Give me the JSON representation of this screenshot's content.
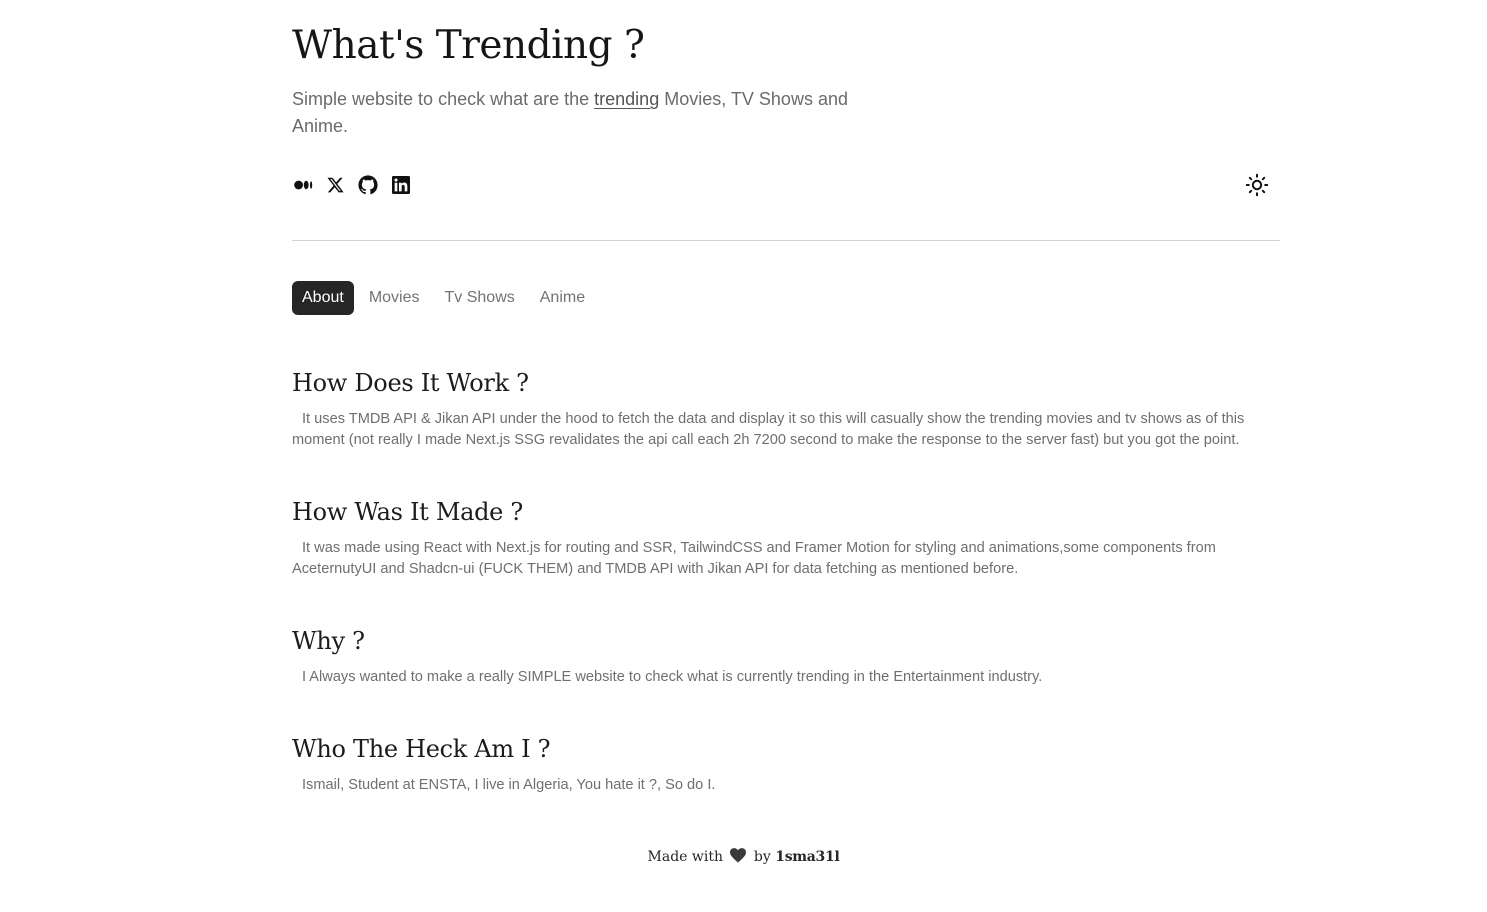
{
  "header": {
    "title": "What's Trending ?",
    "subtitle_before": "Simple website to check what are the ",
    "subtitle_link": "trending",
    "subtitle_after": " Movies, TV Shows and Anime."
  },
  "socials": [
    {
      "icon": "medium-icon"
    },
    {
      "icon": "x-icon"
    },
    {
      "icon": "github-icon"
    },
    {
      "icon": "linkedin-icon"
    }
  ],
  "theme_toggle": {
    "icon": "sun-icon"
  },
  "tabs": [
    {
      "label": "About",
      "active": true
    },
    {
      "label": "Movies",
      "active": false
    },
    {
      "label": "Tv Shows",
      "active": false
    },
    {
      "label": "Anime",
      "active": false
    }
  ],
  "sections": [
    {
      "heading": "How Does It Work ?",
      "body": "It uses TMDB API & Jikan API under the hood to fetch the data and display it so this will casually show the trending movies and tv shows as of this moment (not really I made Next.js SSG revalidates the api call each 2h 7200 second to make the response to the server fast) but you got the point."
    },
    {
      "heading": "How Was It Made ?",
      "body": "It was made using React with Next.js for routing and SSR, TailwindCSS and Framer Motion for styling and animations,some components from AceternutyUI and Shadcn-ui (FUCK THEM) and TMDB API with Jikan API for data fetching as mentioned before."
    },
    {
      "heading": "Why ?",
      "body": "I Always wanted to make a really SIMPLE website to check what is currently trending in the Entertainment industry."
    },
    {
      "heading": "Who The Heck Am I ?",
      "body": "Ismail, Student at ENSTA, I live in Algeria, You hate it ?, So do I."
    }
  ],
  "footer": {
    "made_with": "Made with",
    "heart_icon": "heart-icon",
    "by": "by",
    "author": "1sma31l"
  },
  "colors": {
    "active_tab_bg": "#262626",
    "active_tab_text": "#ffffff",
    "muted_text": "#737373",
    "divider": "#d4d4d4"
  }
}
